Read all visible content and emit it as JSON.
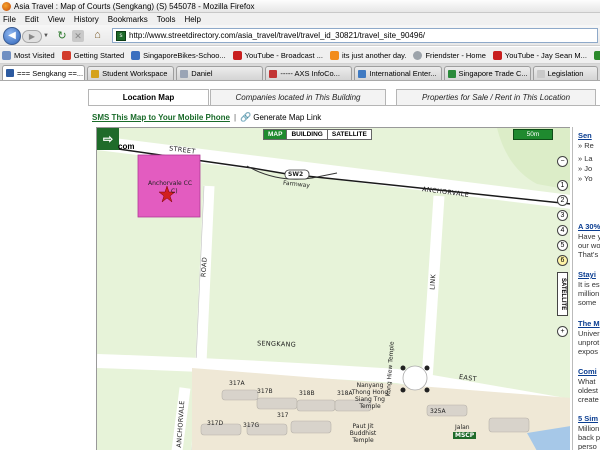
{
  "window": {
    "title": "Asia Travel : Map of Courts (Sengkang) (S) 545078 - Mozilla Firefox"
  },
  "menu": [
    "File",
    "Edit",
    "View",
    "History",
    "Bookmarks",
    "Tools",
    "Help"
  ],
  "nav": {
    "url": "http://www.streetdirectory.com/asia_travel/travel/travel_id_30821/travel_site_90496/",
    "back_icon": "back-arrow-icon",
    "forward_icon": "forward-arrow-icon",
    "reload_icon": "reload-icon",
    "stop_icon": "stop-icon",
    "home_icon": "home-icon"
  },
  "bookmarks": [
    {
      "label": "Most Visited",
      "color": "#6f8fc2"
    },
    {
      "label": "Getting Started",
      "color": "#d23b2b"
    },
    {
      "label": "SingaporeBikes-Schoo...",
      "color": "#3b6fbf"
    },
    {
      "label": "YouTube - Broadcast ...",
      "color": "#c81e1e"
    },
    {
      "label": "its just another day.",
      "color": "#f28c1b"
    },
    {
      "label": "Friendster - Home",
      "color": "#9ca3aa"
    },
    {
      "label": "YouTube - Jay Sean M...",
      "color": "#c81e1e"
    },
    {
      "label": "O",
      "color": "#2c8a2c"
    }
  ],
  "tabs": [
    {
      "label": "=== Sengkang ==...",
      "color": "#2c5aa0",
      "active": true
    },
    {
      "label": "Student Workspace",
      "color": "#d5a21b",
      "active": false
    },
    {
      "label": "Daniel",
      "color": "#9aa4b5",
      "active": false
    },
    {
      "label": "----- AXS InfoCo...",
      "color": "#c23434",
      "active": false
    },
    {
      "label": "International Enter...",
      "color": "#3f7ac2",
      "active": false
    },
    {
      "label": "Singapore Trade C...",
      "color": "#2a8a3a",
      "active": false
    },
    {
      "label": "Legislation",
      "color": "#c9c9c9",
      "active": false
    }
  ],
  "page": {
    "tabs": [
      "Location Map",
      "Companies located in This Building",
      "Properties for Sale / Rent in This Location"
    ],
    "sms_link": "SMS This Map to Your Mobile Phone",
    "separator": "|",
    "generate_link": "Generate Map Link",
    "map_types": [
      "MAP",
      "BUILDING",
      "SATELLITE"
    ],
    "scale": "50m",
    "logo_text": "com",
    "zoom_levels": [
      "1",
      "2",
      "3",
      "4",
      "5",
      "6"
    ],
    "current_zoom": "6",
    "satellite_toggle": "SATELLITE",
    "map_labels": {
      "street_top": "STREET",
      "sw2": "SW2",
      "farmway": "Farmway",
      "anchorvale": "ANCHORVALE",
      "anchorvale_cc": "Anchorvale CC",
      "cc_suffix": "C)",
      "road": "ROAD",
      "link": "LINK",
      "sengkang": "SENGKANG",
      "east": "EAST",
      "anchorvale_vert": "ANCHORVALE",
      "blocks": [
        "317A",
        "317B",
        "318B",
        "318A",
        "317",
        "317D",
        "317G",
        "325A"
      ],
      "temple": "Nanyang Thong Hong Siang Tng Temple",
      "kong_hiew": "Kong Hiew Temple",
      "paut_jit": "Paut Jit Buddhist Temple",
      "mscp": "MSCP",
      "jalan": "Jalan"
    },
    "right_panel": [
      {
        "text": "Sen",
        "type": "head"
      },
      {
        "text": "» Re",
        "type": "text"
      },
      {
        "text": "» La",
        "type": "text"
      },
      {
        "text": "» Jo",
        "type": "text"
      },
      {
        "text": "» Yo",
        "type": "text"
      },
      {
        "text": "A 30%",
        "type": "head"
      },
      {
        "text": "Have y",
        "type": "text"
      },
      {
        "text": "our wo",
        "type": "text"
      },
      {
        "text": "That's",
        "type": "text"
      },
      {
        "text": "Stayi",
        "type": "head"
      },
      {
        "text": "It is es",
        "type": "text"
      },
      {
        "text": "million",
        "type": "text"
      },
      {
        "text": "some",
        "type": "text"
      },
      {
        "text": "The M",
        "type": "head"
      },
      {
        "text": "Univer",
        "type": "text"
      },
      {
        "text": "unprot",
        "type": "text"
      },
      {
        "text": "expos",
        "type": "text"
      },
      {
        "text": "Comi",
        "type": "head"
      },
      {
        "text": "What",
        "type": "text"
      },
      {
        "text": "oldest",
        "type": "text"
      },
      {
        "text": "create",
        "type": "text"
      },
      {
        "text": "5 Sim",
        "type": "head"
      },
      {
        "text": "Million",
        "type": "text"
      },
      {
        "text": "back p",
        "type": "text"
      },
      {
        "text": "perso",
        "type": "text"
      }
    ]
  }
}
